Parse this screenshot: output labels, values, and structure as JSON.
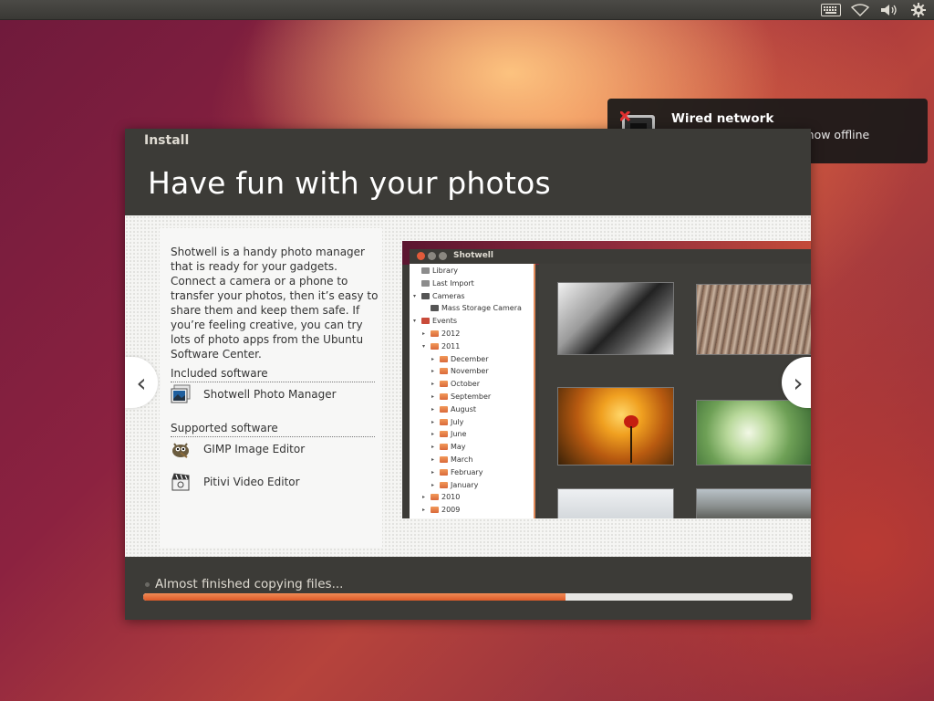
{
  "indicators": {
    "icons": [
      "keyboard-icon",
      "wifi-icon",
      "volume-icon",
      "gear-icon"
    ]
  },
  "notification": {
    "title": "Wired network",
    "body": "Disconnected - you are now offline",
    "icon": "network-disconnected-icon"
  },
  "installer": {
    "window_title": "Install",
    "slide_title": "Have fun with your photos",
    "description": "Shotwell is a handy photo manager that is ready for your gadgets. Connect a camera or a phone to transfer your photos, then it’s easy to share them and keep them safe. If you’re feeling creative, you can try lots of photo apps from the Ubuntu Software Center.",
    "included_heading": "Included software",
    "included": [
      {
        "name": "Shotwell Photo Manager",
        "icon": "shotwell-icon"
      }
    ],
    "supported_heading": "Supported software",
    "supported": [
      {
        "name": "GIMP Image Editor",
        "icon": "gimp-icon"
      },
      {
        "name": "Pitivi Video Editor",
        "icon": "pitivi-icon"
      }
    ],
    "nav_prev": "‹",
    "nav_next": "›",
    "progress_label": "Almost finished copying files...",
    "progress_fraction": 0.65
  },
  "shotwell": {
    "title": "Shotwell",
    "tree": [
      {
        "label": "Library",
        "depth": 0,
        "arrow": "",
        "icon": "lib-ico"
      },
      {
        "label": "Last Import",
        "depth": 0,
        "arrow": "",
        "icon": "lib-ico"
      },
      {
        "label": "Cameras",
        "depth": 0,
        "arrow": "▾",
        "icon": "cam-ico"
      },
      {
        "label": "Mass Storage Camera",
        "depth": 1,
        "arrow": "",
        "icon": "cam-ico"
      },
      {
        "label": "Events",
        "depth": 0,
        "arrow": "▾",
        "icon": "evt-ico"
      },
      {
        "label": "2012",
        "depth": 1,
        "arrow": "▸",
        "icon": "fold"
      },
      {
        "label": "2011",
        "depth": 1,
        "arrow": "▾",
        "icon": "fold"
      },
      {
        "label": "December",
        "depth": 2,
        "arrow": "▸",
        "icon": "fold"
      },
      {
        "label": "November",
        "depth": 2,
        "arrow": "▸",
        "icon": "fold"
      },
      {
        "label": "October",
        "depth": 2,
        "arrow": "▸",
        "icon": "fold"
      },
      {
        "label": "September",
        "depth": 2,
        "arrow": "▸",
        "icon": "fold"
      },
      {
        "label": "August",
        "depth": 2,
        "arrow": "▸",
        "icon": "fold"
      },
      {
        "label": "July",
        "depth": 2,
        "arrow": "▸",
        "icon": "fold"
      },
      {
        "label": "June",
        "depth": 2,
        "arrow": "▸",
        "icon": "fold"
      },
      {
        "label": "May",
        "depth": 2,
        "arrow": "▸",
        "icon": "fold"
      },
      {
        "label": "March",
        "depth": 2,
        "arrow": "▸",
        "icon": "fold"
      },
      {
        "label": "February",
        "depth": 2,
        "arrow": "▸",
        "icon": "fold"
      },
      {
        "label": "January",
        "depth": 2,
        "arrow": "▸",
        "icon": "fold"
      },
      {
        "label": "2010",
        "depth": 1,
        "arrow": "▸",
        "icon": "fold"
      },
      {
        "label": "2009",
        "depth": 1,
        "arrow": "▸",
        "icon": "fold"
      }
    ],
    "thumbnails": [
      "piano-keys-photo",
      "roof-tiles-photo",
      "poppy-sunset-photo",
      "succulent-photo",
      "misty-landscape-photo",
      "dusk-landscape-photo"
    ]
  }
}
